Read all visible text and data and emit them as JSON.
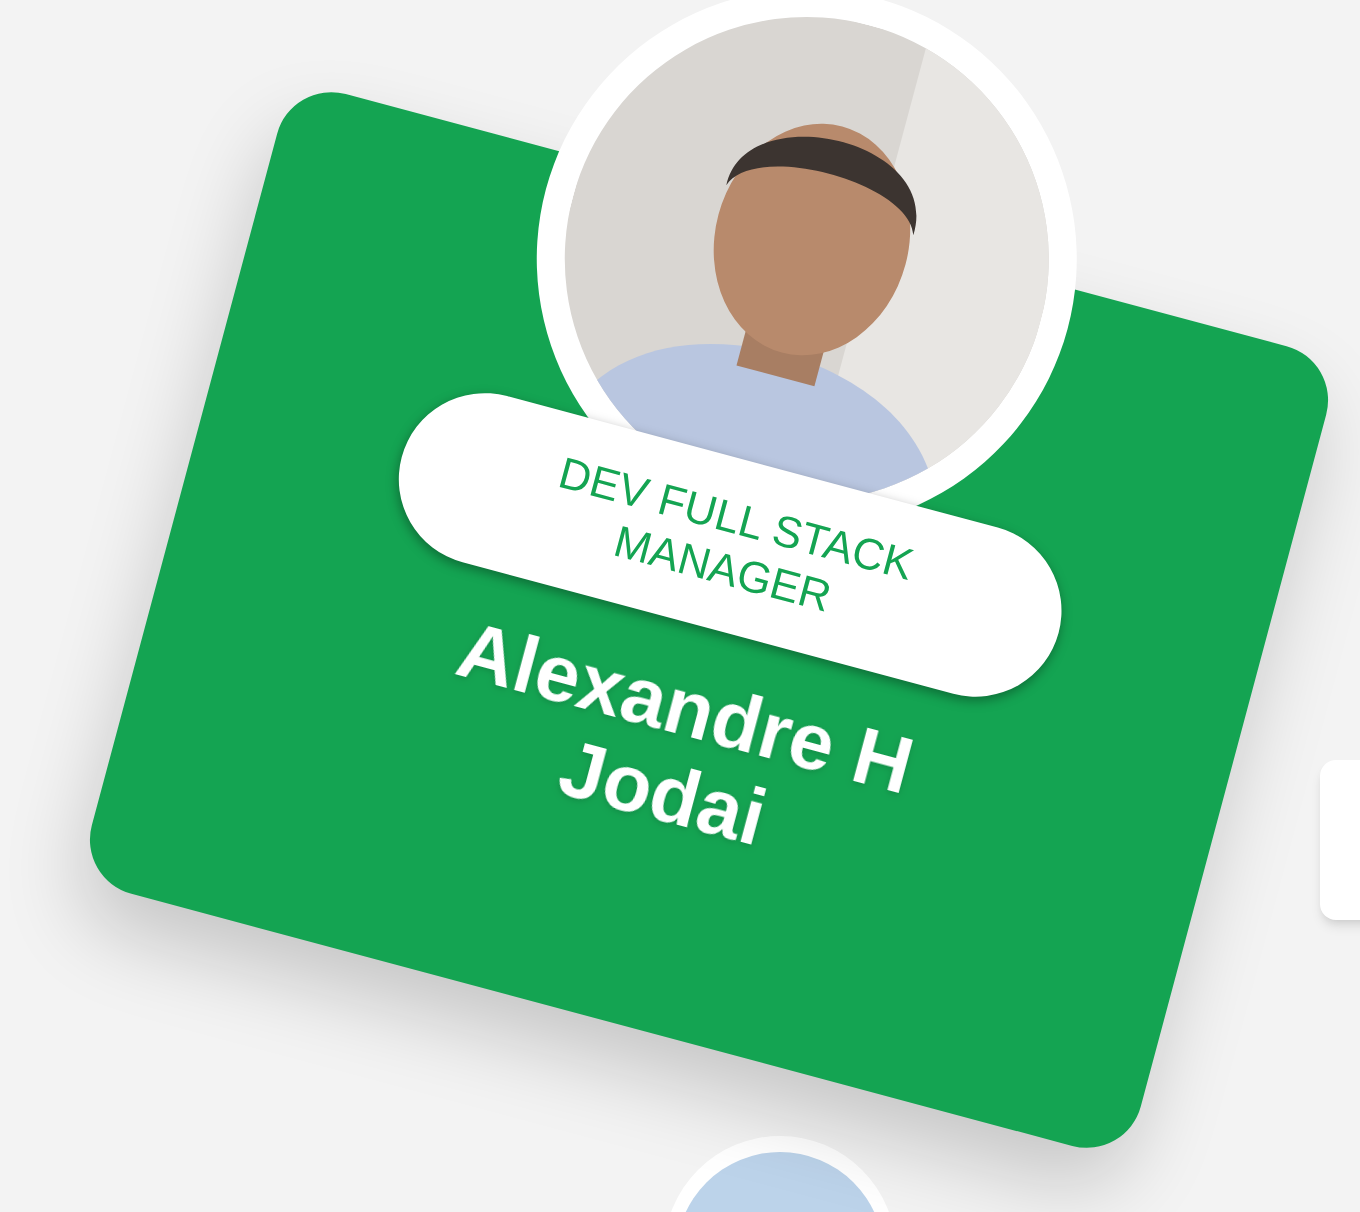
{
  "profile_card": {
    "role": "DEV FULL STACK MANAGER",
    "name": "Alexandre H Jodai"
  }
}
